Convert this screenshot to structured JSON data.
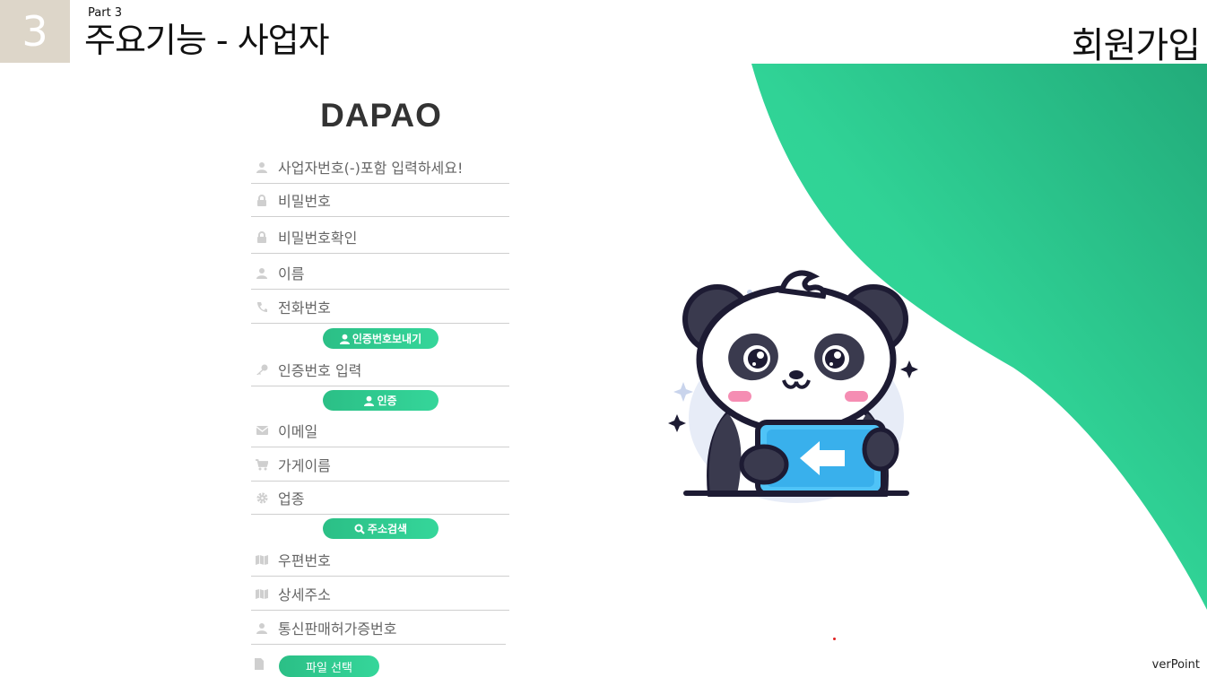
{
  "slide": {
    "number": "3",
    "part": "Part 3",
    "title": "주요기능 - 사업자",
    "right_title": "회원가입",
    "footer": "verPoint"
  },
  "form": {
    "logo": "DAPAO",
    "fields": [
      {
        "icon": "user-icon",
        "placeholder": "사업자번호(-)포함 입력하세요!"
      },
      {
        "icon": "lock-icon",
        "placeholder": "비밀번호"
      },
      {
        "icon": "lock-icon",
        "placeholder": "비밀번호확인"
      },
      {
        "icon": "user-icon",
        "placeholder": "이름"
      },
      {
        "icon": "phone-icon",
        "placeholder": "전화번호"
      },
      {
        "icon": "key-icon",
        "placeholder": "인증번호 입력"
      },
      {
        "icon": "envelope-icon",
        "placeholder": "이메일"
      },
      {
        "icon": "cart-icon",
        "placeholder": "가게이름"
      },
      {
        "icon": "gear-icon",
        "placeholder": "업종"
      },
      {
        "icon": "map-icon",
        "placeholder": "우편번호"
      },
      {
        "icon": "map-icon",
        "placeholder": "상세주소"
      },
      {
        "icon": "user-icon",
        "placeholder": "통신판매허가증번호"
      }
    ],
    "buttons": {
      "send_code": "인증번호보내기",
      "verify": "인증",
      "address_search": "주소검색",
      "file_select": "파일 선택"
    }
  },
  "colors": {
    "accent": "#2ecc8f",
    "slide_number_bg": "#ddd6c9"
  }
}
